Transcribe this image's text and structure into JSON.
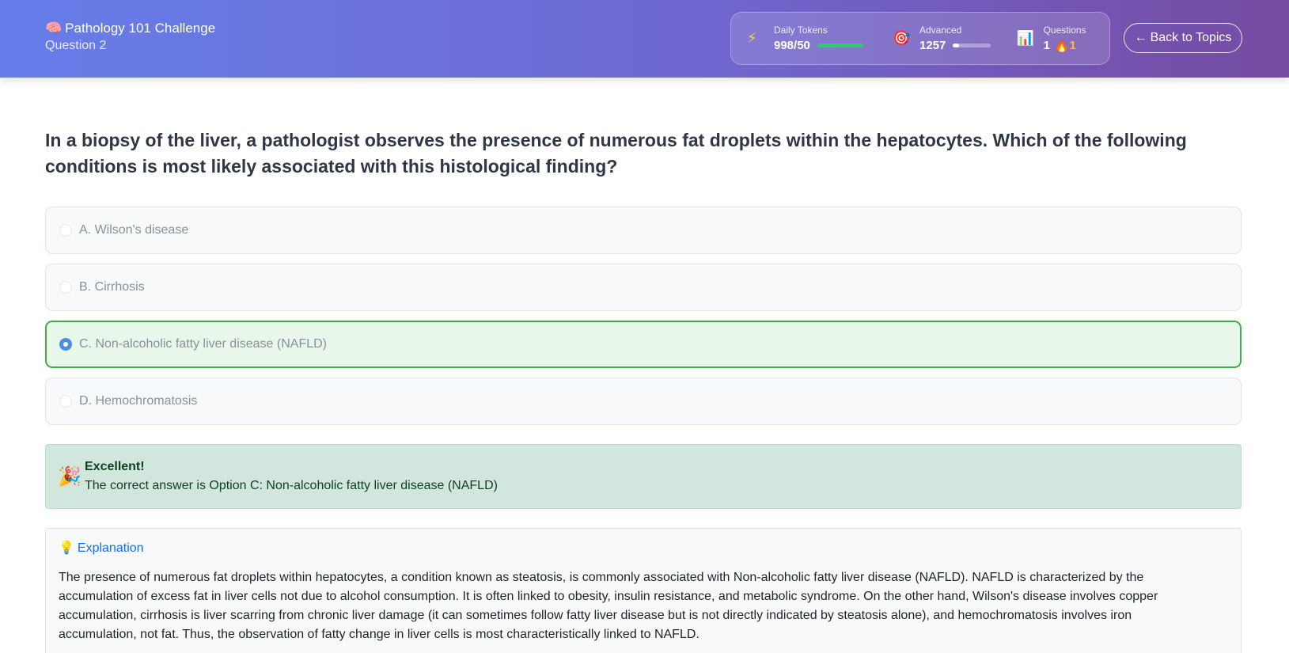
{
  "header": {
    "title": "Pathology 101 Challenge",
    "title_icon": "brain-icon",
    "subtitle": "Question 2",
    "stats": {
      "tokens": {
        "icon": "lightning-icon",
        "label": "Daily Tokens",
        "value": "998/50",
        "progress": 1.0,
        "color": "#2ecc71"
      },
      "level": {
        "icon": "target-icon",
        "label": "Advanced",
        "value": "1257",
        "progress": 0.15,
        "color": "#ffffff"
      },
      "questions": {
        "icon": "bar-chart-icon",
        "label": "Questions",
        "value": "1",
        "streak_icon": "fire-icon",
        "streak": "1",
        "streak_color": "#fbbf24"
      }
    },
    "back_button": {
      "icon": "arrow-left-icon",
      "label": "Back to Topics"
    }
  },
  "question": {
    "text": "In a biopsy of the liver, a pathologist observes the presence of numerous fat droplets within the hepatocytes. Which of the following conditions is most likely associated with this histological finding?"
  },
  "options": [
    {
      "label": "A. Wilson's disease",
      "selected": false
    },
    {
      "label": "B. Cirrhosis",
      "selected": false
    },
    {
      "label": "C. Non-alcoholic fatty liver disease (NAFLD)",
      "selected": true
    },
    {
      "label": "D. Hemochromatosis",
      "selected": false
    }
  ],
  "feedback": {
    "icon": "party-popper-icon",
    "title": "Excellent!",
    "text": "The correct answer is Option C: Non-alcoholic fatty liver disease (NAFLD)"
  },
  "explanation": {
    "icon": "lightbulb-icon",
    "title": "Explanation",
    "text": "The presence of numerous fat droplets within hepatocytes, a condition known as steatosis, is commonly associated with Non-alcoholic fatty liver disease (NAFLD). NAFLD is characterized by the accumulation of excess fat in liver cells not due to alcohol consumption. It is often linked to obesity, insulin resistance, and metabolic syndrome. On the other hand, Wilson's disease involves copper accumulation, cirrhosis is liver scarring from chronic liver damage (it can sometimes follow fatty liver disease but is not directly indicated by steatosis alone), and hemochromatosis involves iron accumulation, not fat. Thus, the observation of fatty change in liver cells is most characteristically linked to NAFLD."
  },
  "colors": {
    "header_gradient_start": "#667eea",
    "header_gradient_end": "#764ba2",
    "correct_border": "#3fae4a",
    "correct_bg": "#e9f6ea",
    "feedback_bg": "#d1e7dd",
    "link": "#0d6efd"
  }
}
